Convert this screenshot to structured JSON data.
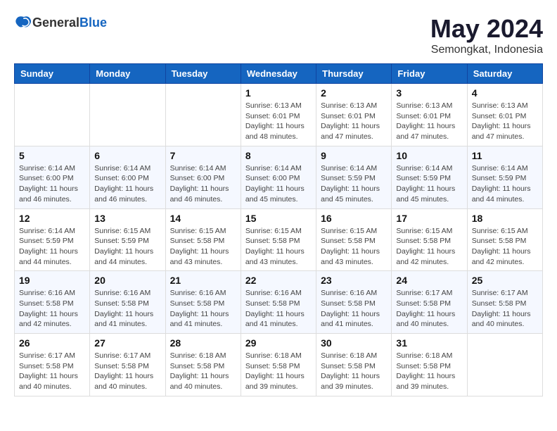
{
  "logo": {
    "text_general": "General",
    "text_blue": "Blue"
  },
  "title": "May 2024",
  "subtitle": "Semongkat, Indonesia",
  "days_header": [
    "Sunday",
    "Monday",
    "Tuesday",
    "Wednesday",
    "Thursday",
    "Friday",
    "Saturday"
  ],
  "weeks": [
    [
      {
        "day": "",
        "info": ""
      },
      {
        "day": "",
        "info": ""
      },
      {
        "day": "",
        "info": ""
      },
      {
        "day": "1",
        "info": "Sunrise: 6:13 AM\nSunset: 6:01 PM\nDaylight: 11 hours and 48 minutes."
      },
      {
        "day": "2",
        "info": "Sunrise: 6:13 AM\nSunset: 6:01 PM\nDaylight: 11 hours and 47 minutes."
      },
      {
        "day": "3",
        "info": "Sunrise: 6:13 AM\nSunset: 6:01 PM\nDaylight: 11 hours and 47 minutes."
      },
      {
        "day": "4",
        "info": "Sunrise: 6:13 AM\nSunset: 6:01 PM\nDaylight: 11 hours and 47 minutes."
      }
    ],
    [
      {
        "day": "5",
        "info": "Sunrise: 6:14 AM\nSunset: 6:00 PM\nDaylight: 11 hours and 46 minutes."
      },
      {
        "day": "6",
        "info": "Sunrise: 6:14 AM\nSunset: 6:00 PM\nDaylight: 11 hours and 46 minutes."
      },
      {
        "day": "7",
        "info": "Sunrise: 6:14 AM\nSunset: 6:00 PM\nDaylight: 11 hours and 46 minutes."
      },
      {
        "day": "8",
        "info": "Sunrise: 6:14 AM\nSunset: 6:00 PM\nDaylight: 11 hours and 45 minutes."
      },
      {
        "day": "9",
        "info": "Sunrise: 6:14 AM\nSunset: 5:59 PM\nDaylight: 11 hours and 45 minutes."
      },
      {
        "day": "10",
        "info": "Sunrise: 6:14 AM\nSunset: 5:59 PM\nDaylight: 11 hours and 45 minutes."
      },
      {
        "day": "11",
        "info": "Sunrise: 6:14 AM\nSunset: 5:59 PM\nDaylight: 11 hours and 44 minutes."
      }
    ],
    [
      {
        "day": "12",
        "info": "Sunrise: 6:14 AM\nSunset: 5:59 PM\nDaylight: 11 hours and 44 minutes."
      },
      {
        "day": "13",
        "info": "Sunrise: 6:15 AM\nSunset: 5:59 PM\nDaylight: 11 hours and 44 minutes."
      },
      {
        "day": "14",
        "info": "Sunrise: 6:15 AM\nSunset: 5:58 PM\nDaylight: 11 hours and 43 minutes."
      },
      {
        "day": "15",
        "info": "Sunrise: 6:15 AM\nSunset: 5:58 PM\nDaylight: 11 hours and 43 minutes."
      },
      {
        "day": "16",
        "info": "Sunrise: 6:15 AM\nSunset: 5:58 PM\nDaylight: 11 hours and 43 minutes."
      },
      {
        "day": "17",
        "info": "Sunrise: 6:15 AM\nSunset: 5:58 PM\nDaylight: 11 hours and 42 minutes."
      },
      {
        "day": "18",
        "info": "Sunrise: 6:15 AM\nSunset: 5:58 PM\nDaylight: 11 hours and 42 minutes."
      }
    ],
    [
      {
        "day": "19",
        "info": "Sunrise: 6:16 AM\nSunset: 5:58 PM\nDaylight: 11 hours and 42 minutes."
      },
      {
        "day": "20",
        "info": "Sunrise: 6:16 AM\nSunset: 5:58 PM\nDaylight: 11 hours and 41 minutes."
      },
      {
        "day": "21",
        "info": "Sunrise: 6:16 AM\nSunset: 5:58 PM\nDaylight: 11 hours and 41 minutes."
      },
      {
        "day": "22",
        "info": "Sunrise: 6:16 AM\nSunset: 5:58 PM\nDaylight: 11 hours and 41 minutes."
      },
      {
        "day": "23",
        "info": "Sunrise: 6:16 AM\nSunset: 5:58 PM\nDaylight: 11 hours and 41 minutes."
      },
      {
        "day": "24",
        "info": "Sunrise: 6:17 AM\nSunset: 5:58 PM\nDaylight: 11 hours and 40 minutes."
      },
      {
        "day": "25",
        "info": "Sunrise: 6:17 AM\nSunset: 5:58 PM\nDaylight: 11 hours and 40 minutes."
      }
    ],
    [
      {
        "day": "26",
        "info": "Sunrise: 6:17 AM\nSunset: 5:58 PM\nDaylight: 11 hours and 40 minutes."
      },
      {
        "day": "27",
        "info": "Sunrise: 6:17 AM\nSunset: 5:58 PM\nDaylight: 11 hours and 40 minutes."
      },
      {
        "day": "28",
        "info": "Sunrise: 6:18 AM\nSunset: 5:58 PM\nDaylight: 11 hours and 40 minutes."
      },
      {
        "day": "29",
        "info": "Sunrise: 6:18 AM\nSunset: 5:58 PM\nDaylight: 11 hours and 39 minutes."
      },
      {
        "day": "30",
        "info": "Sunrise: 6:18 AM\nSunset: 5:58 PM\nDaylight: 11 hours and 39 minutes."
      },
      {
        "day": "31",
        "info": "Sunrise: 6:18 AM\nSunset: 5:58 PM\nDaylight: 11 hours and 39 minutes."
      },
      {
        "day": "",
        "info": ""
      }
    ]
  ]
}
